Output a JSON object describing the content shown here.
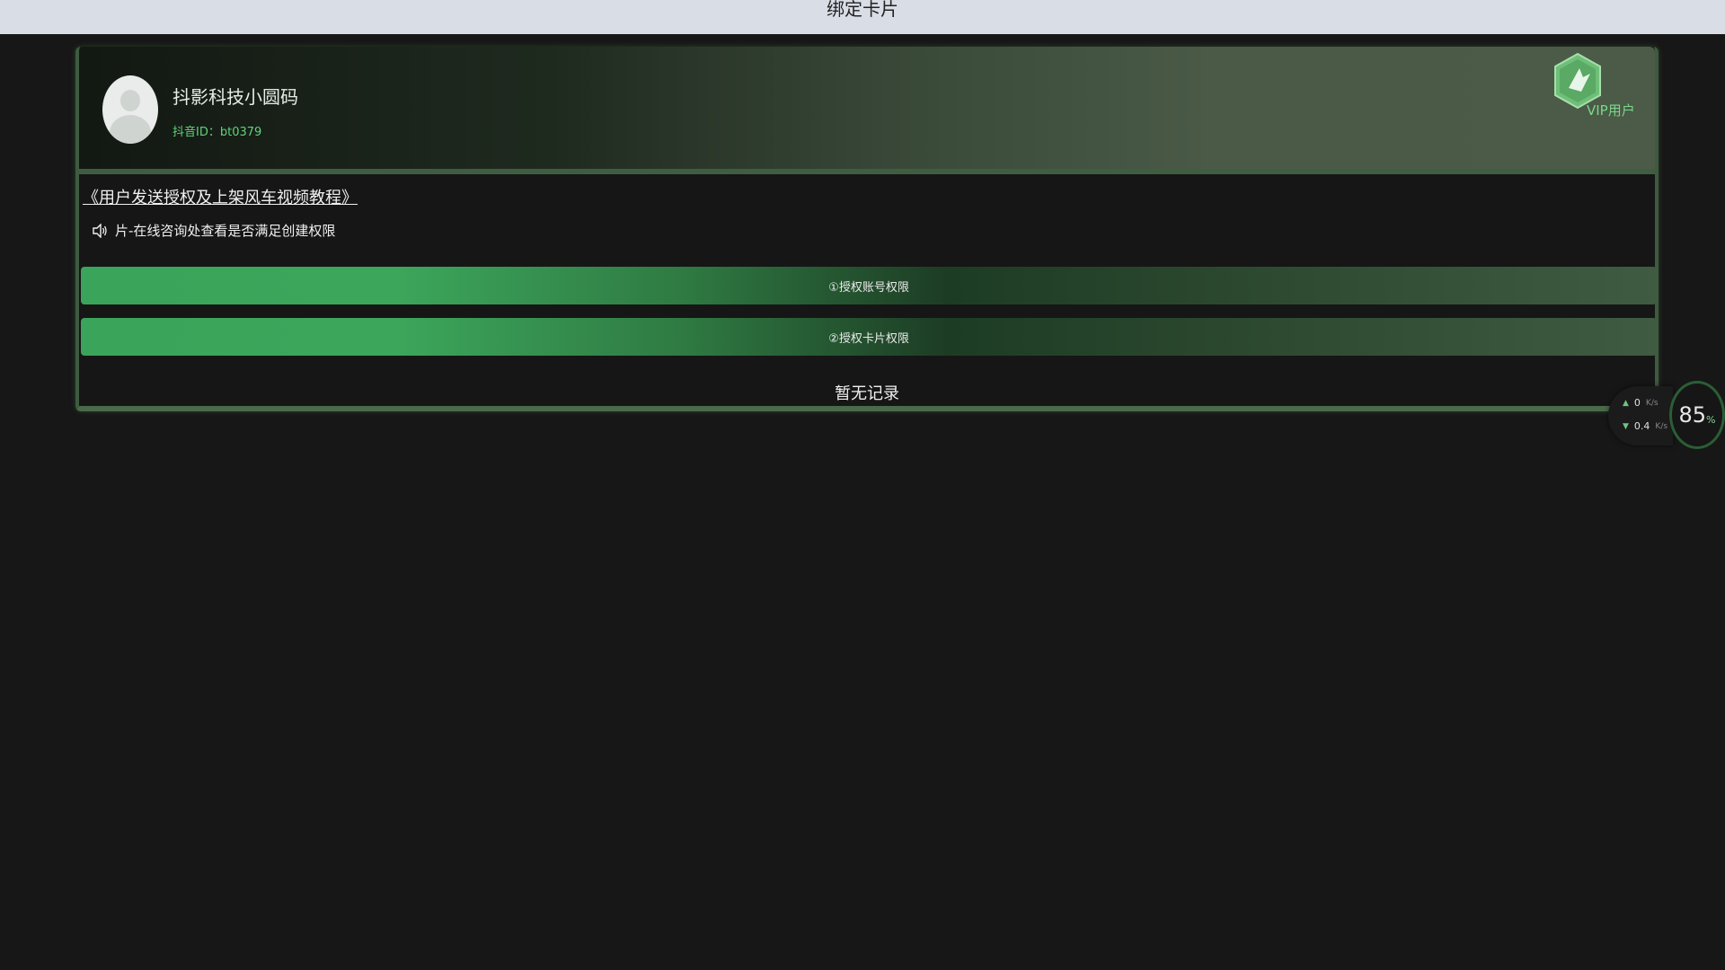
{
  "window": {
    "title": "绑定卡片"
  },
  "profile": {
    "name": "抖影科技小圆码",
    "id_text": "抖音ID：bt0379",
    "badge": "VIP用户"
  },
  "tutorial_link": "《用户发送授权及上架风车视频教程》",
  "notice": "片-在线咨询处查看是否满足创建权限",
  "buttons": {
    "account_permission": "①授权账号权限",
    "card_permission": "②授权卡片权限"
  },
  "empty_text": "暂无记录",
  "speed_monitor": {
    "upload_value": "0",
    "download_value": "0.4",
    "unit": "K/s",
    "gauge_value": "85",
    "gauge_unit": "%"
  },
  "colors": {
    "accent_green": "#3aa55a",
    "vip_green": "#7bd68d",
    "background": "#171717"
  }
}
